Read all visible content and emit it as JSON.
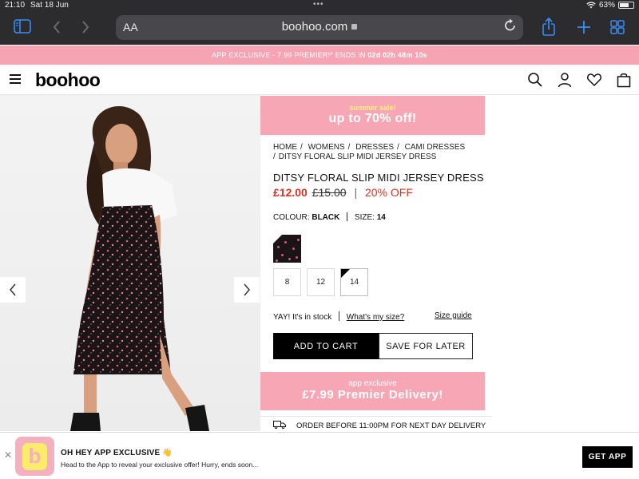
{
  "status_bar": {
    "time": "21:10",
    "date": "Sat 18 Jun",
    "battery": "63%"
  },
  "browser": {
    "aa_label": "AA",
    "url": "boohoo.com",
    "icons": {
      "sidebar": "sidebar-icon",
      "back": "back-chevron-icon",
      "forward": "forward-chevron-icon",
      "share": "share-icon",
      "new_tab": "plus-icon",
      "tabs": "tabs-grid-icon",
      "reload": "reload-icon"
    },
    "accent_color": "#3a8cf7"
  },
  "promo_strip": {
    "text": "APP EXCLUSIVE - 7.99 PREMIER!* ENDS IN",
    "countdown": "02d 02h 48m 10s",
    "color": "#f6a4b4"
  },
  "header": {
    "logo": "boohoo",
    "icons": [
      "search-icon",
      "account-icon",
      "wishlist-heart-icon",
      "bag-icon"
    ]
  },
  "banner_top": {
    "small": "summer sale!",
    "big": "up to 70% off!"
  },
  "breadcrumb": {
    "items": [
      "HOME",
      "WOMENS",
      "DRESSES",
      "CAMI DRESSES"
    ],
    "current": "DITSY FLORAL SLIP MIDI JERSEY DRESS"
  },
  "product": {
    "title": "DITSY FLORAL SLIP MIDI JERSEY DRESS",
    "price_now": "£12.00",
    "price_was": "£15.00",
    "discount": "20% OFF",
    "colour_label": "COLOUR:",
    "colour_value": "BLACK",
    "size_label": "SIZE:",
    "size_value": "14",
    "sizes": [
      "8",
      "12",
      "14"
    ],
    "selected_size": "14",
    "stock_text": "YAY! It's in stock",
    "whats_my_size": "What's my size?",
    "size_guide": "Size guide",
    "add_to_cart": "ADD TO CART",
    "save_for_later": "SAVE FOR LATER",
    "price_color": "#d83321"
  },
  "banner_bottom": {
    "small": "app exclusive",
    "big": "£7.99 Premier Delivery!"
  },
  "delivery": {
    "text": "ORDER BEFORE 11:00PM FOR NEXT DAY DELIVERY"
  },
  "app_banner": {
    "title": "OH HEY APP EXCLUSIVE 👋",
    "subtitle": "Head to the App to reveal your exclusive offer! Hurry, ends soon...",
    "button": "GET APP",
    "icon_letter": "b"
  }
}
